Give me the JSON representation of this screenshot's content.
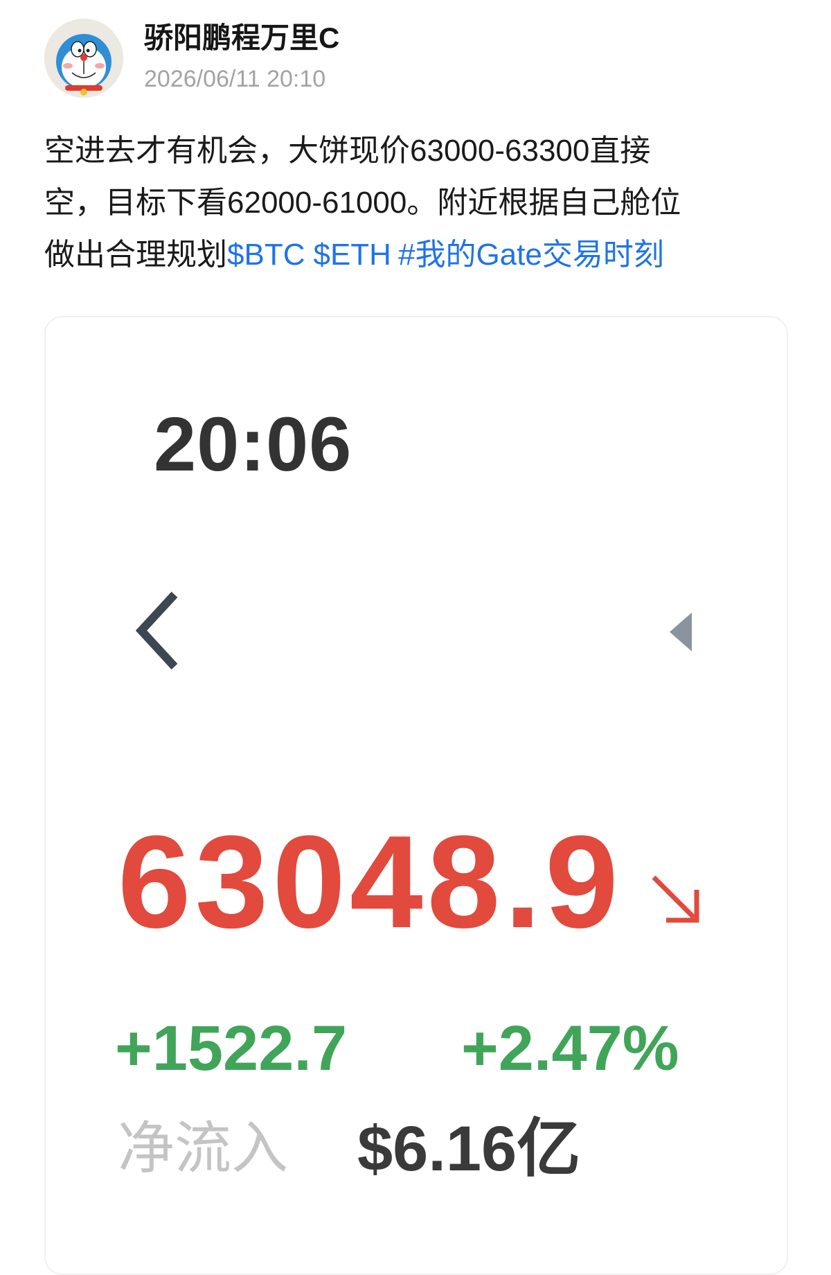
{
  "post": {
    "author_name": "骄阳鹏程万里C",
    "timestamp": "2026/06/11 20:10",
    "text_lines": [
      "空进去才有机会，大饼现价63000-63300直接",
      "空，目标下看62000-61000。附近根据自己舱位",
      "做出合理规划"
    ],
    "tags": [
      "$BTC",
      "$ETH",
      "#我的Gate交易时刻"
    ],
    "avatar_icon": "doraemon-avatar-icon"
  },
  "screenshot_card": {
    "clock": "20:06",
    "back_icon": "chevron-left-icon",
    "collapse_icon": "caret-left-icon",
    "price": "63048.9",
    "trend_icon": "arrow-down-right-icon",
    "change_abs": "+1522.7",
    "change_pct": "+2.47%",
    "netflow_label": "净流入",
    "netflow_value": "$6.16亿"
  },
  "colors": {
    "link": "#1f73e8",
    "price_red": "#e14a3d",
    "gain_green": "#41a559",
    "muted_gray": "#a3a3a3"
  }
}
